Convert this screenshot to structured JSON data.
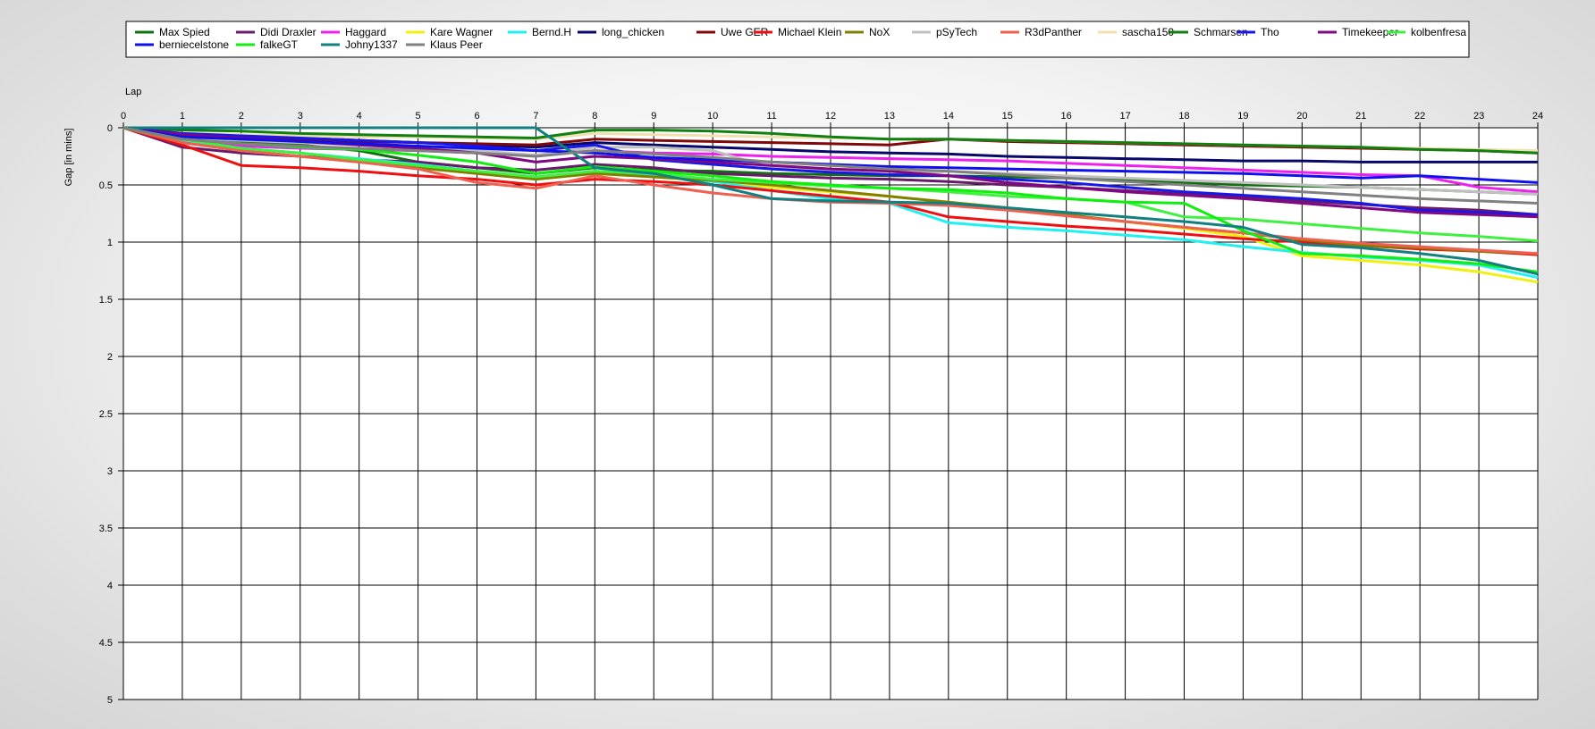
{
  "chart_data": {
    "type": "line",
    "xlabel": "Lap",
    "ylabel": "Gap [in mins]",
    "xlim": [
      0,
      24
    ],
    "ylim": [
      0,
      5
    ],
    "y_inverted": true,
    "x_ticks": [
      0,
      1,
      2,
      3,
      4,
      5,
      6,
      7,
      8,
      9,
      10,
      11,
      12,
      13,
      14,
      15,
      16,
      17,
      18,
      19,
      20,
      21,
      22,
      23,
      24
    ],
    "y_ticks": [
      0,
      0.5,
      1,
      1.5,
      2,
      2.5,
      3,
      3.5,
      4,
      4.5,
      5
    ],
    "grid": true,
    "legend_position": "top",
    "series": [
      {
        "name": "Max Spied",
        "color": "#107010",
        "values": [
          0,
          0.08,
          0.12,
          0.15,
          0.2,
          0.3,
          0.35,
          0.4,
          0.35,
          0.37,
          0.38,
          0.4,
          0.41,
          0.42,
          0.42,
          0.43,
          0.44,
          0.46,
          0.48,
          0.5,
          0.51,
          0.52,
          0.54,
          0.56,
          0.58
        ]
      },
      {
        "name": "Didi Draxler",
        "color": "#6a1a6a",
        "values": [
          0,
          0.17,
          0.22,
          0.25,
          0.28,
          0.3,
          0.35,
          0.37,
          0.32,
          0.35,
          0.4,
          0.42,
          0.44,
          0.45,
          0.47,
          0.5,
          0.52,
          0.55,
          0.58,
          0.61,
          0.64,
          0.67,
          0.7,
          0.72,
          0.76
        ]
      },
      {
        "name": "Haggard",
        "color": "#ee20ee",
        "values": [
          0,
          0.12,
          0.16,
          0.18,
          0.19,
          0.2,
          0.22,
          0.24,
          0.2,
          0.22,
          0.23,
          0.25,
          0.26,
          0.27,
          0.28,
          0.29,
          0.31,
          0.33,
          0.35,
          0.37,
          0.39,
          0.41,
          0.42,
          0.52,
          0.56
        ]
      },
      {
        "name": "Kare Wagner",
        "color": "#f0f010",
        "values": [
          0,
          0.12,
          0.2,
          0.25,
          0.3,
          0.35,
          0.4,
          0.45,
          0.4,
          0.43,
          0.47,
          0.52,
          0.56,
          0.6,
          0.65,
          0.7,
          0.76,
          0.82,
          0.88,
          0.95,
          1.12,
          1.16,
          1.2,
          1.26,
          1.35
        ]
      },
      {
        "name": "Bernd.H",
        "color": "#20f0f0",
        "values": [
          0,
          0.12,
          0.18,
          0.22,
          0.27,
          0.32,
          0.38,
          0.43,
          0.38,
          0.42,
          0.47,
          0.55,
          0.62,
          0.66,
          0.83,
          0.87,
          0.9,
          0.94,
          0.98,
          1.04,
          1.09,
          1.13,
          1.16,
          1.2,
          1.31
        ]
      },
      {
        "name": "long_chicken",
        "color": "#08086a",
        "values": [
          0,
          0.05,
          0.07,
          0.09,
          0.11,
          0.13,
          0.15,
          0.17,
          0.13,
          0.15,
          0.17,
          0.19,
          0.21,
          0.22,
          0.23,
          0.25,
          0.26,
          0.27,
          0.28,
          0.29,
          0.29,
          0.3,
          0.3,
          0.3,
          0.3
        ]
      },
      {
        "name": "Uwe GER",
        "color": "#800808",
        "values": [
          0,
          0.06,
          0.08,
          0.1,
          0.12,
          0.13,
          0.14,
          0.15,
          0.1,
          0.11,
          0.12,
          0.13,
          0.14,
          0.15,
          0.1,
          0.12,
          0.13,
          0.14,
          0.15,
          0.16,
          0.17,
          0.18,
          0.19,
          0.2,
          0.22
        ]
      },
      {
        "name": "Michael Klein",
        "color": "#ee1010",
        "values": [
          0,
          0.15,
          0.33,
          0.35,
          0.38,
          0.42,
          0.45,
          0.5,
          0.45,
          0.47,
          0.5,
          0.55,
          0.6,
          0.65,
          0.78,
          0.82,
          0.86,
          0.89,
          0.93,
          0.97,
          1.0,
          1.03,
          1.06,
          1.08,
          1.11
        ]
      },
      {
        "name": "NoX",
        "color": "#808000",
        "values": [
          0,
          0.13,
          0.2,
          0.25,
          0.3,
          0.35,
          0.4,
          0.45,
          0.4,
          0.43,
          0.46,
          0.5,
          0.55,
          0.6,
          0.65,
          0.7,
          0.76,
          0.82,
          0.87,
          0.92,
          0.98,
          1.03,
          1.05,
          1.08,
          1.1
        ]
      },
      {
        "name": "pSyTech",
        "color": "#c0c0c0",
        "values": [
          0,
          0.09,
          0.11,
          0.13,
          0.15,
          0.17,
          0.2,
          0.24,
          0.17,
          0.17,
          0.2,
          0.35,
          0.38,
          0.41,
          0.38,
          0.4,
          0.42,
          0.44,
          0.46,
          0.48,
          0.5,
          0.52,
          0.54,
          0.56,
          0.58
        ]
      },
      {
        "name": "R3dPanther",
        "color": "#f06050",
        "values": [
          0,
          0.13,
          0.2,
          0.25,
          0.3,
          0.36,
          0.48,
          0.53,
          0.42,
          0.5,
          0.57,
          0.62,
          0.65,
          0.66,
          0.68,
          0.72,
          0.77,
          0.82,
          0.87,
          0.92,
          0.97,
          1.01,
          1.04,
          1.07,
          1.1
        ]
      },
      {
        "name": "sascha150",
        "color": "#f0e0b0",
        "values": [
          0,
          0.05,
          0.06,
          0.07,
          0.08,
          0.08,
          0.09,
          0.1,
          0.05,
          0.06,
          0.07,
          0.08,
          0.09,
          0.1,
          0.1,
          0.11,
          0.12,
          0.13,
          0.14,
          0.15,
          0.16,
          0.17,
          0.18,
          0.19,
          0.2
        ]
      },
      {
        "name": "Schmarsen",
        "color": "#108010",
        "values": [
          0,
          0.02,
          0.03,
          0.05,
          0.06,
          0.07,
          0.08,
          0.09,
          0.02,
          0.02,
          0.03,
          0.05,
          0.08,
          0.1,
          0.1,
          0.11,
          0.12,
          0.13,
          0.14,
          0.15,
          0.16,
          0.17,
          0.19,
          0.2,
          0.22
        ]
      },
      {
        "name": "Tho",
        "color": "#1818e8",
        "values": [
          0,
          0.05,
          0.07,
          0.09,
          0.11,
          0.13,
          0.16,
          0.2,
          0.15,
          0.28,
          0.32,
          0.36,
          0.39,
          0.41,
          0.42,
          0.45,
          0.48,
          0.52,
          0.56,
          0.59,
          0.62,
          0.66,
          0.72,
          0.74,
          0.76
        ]
      },
      {
        "name": "Timekeeper",
        "color": "#800880",
        "values": [
          0,
          0.06,
          0.09,
          0.12,
          0.15,
          0.18,
          0.22,
          0.3,
          0.25,
          0.27,
          0.3,
          0.33,
          0.36,
          0.38,
          0.42,
          0.48,
          0.52,
          0.56,
          0.59,
          0.62,
          0.66,
          0.7,
          0.74,
          0.76,
          0.78
        ]
      },
      {
        "name": "kolbenfresa",
        "color": "#40f040",
        "values": [
          0,
          0.1,
          0.18,
          0.22,
          0.28,
          0.33,
          0.38,
          0.43,
          0.38,
          0.4,
          0.45,
          0.48,
          0.51,
          0.53,
          0.56,
          0.6,
          0.62,
          0.65,
          0.78,
          0.8,
          0.84,
          0.88,
          0.92,
          0.95,
          0.99
        ]
      },
      {
        "name": "berniecelstone",
        "color": "#1010ee",
        "values": [
          0,
          0.08,
          0.1,
          0.12,
          0.14,
          0.16,
          0.18,
          0.2,
          0.22,
          0.26,
          0.28,
          0.3,
          0.32,
          0.34,
          0.35,
          0.36,
          0.37,
          0.38,
          0.39,
          0.4,
          0.42,
          0.44,
          0.42,
          0.45,
          0.48
        ]
      },
      {
        "name": "falkeGT",
        "color": "#10ee10",
        "values": [
          0,
          0.1,
          0.14,
          0.17,
          0.19,
          0.24,
          0.3,
          0.4,
          0.34,
          0.38,
          0.42,
          0.47,
          0.5,
          0.53,
          0.54,
          0.57,
          0.62,
          0.65,
          0.66,
          0.9,
          1.1,
          1.12,
          1.15,
          1.19,
          1.26
        ]
      },
      {
        "name": "Johny1337",
        "color": "#108080",
        "values": [
          0,
          0.0,
          0.0,
          0.0,
          0.0,
          0.0,
          0.0,
          0.0,
          0.35,
          0.4,
          0.5,
          0.62,
          0.64,
          0.65,
          0.66,
          0.7,
          0.74,
          0.78,
          0.82,
          0.87,
          1.02,
          1.05,
          1.1,
          1.16,
          1.28
        ]
      },
      {
        "name": "Klaus Peer",
        "color": "#808080",
        "values": [
          0,
          0.1,
          0.14,
          0.16,
          0.18,
          0.2,
          0.22,
          0.25,
          0.2,
          0.23,
          0.26,
          0.3,
          0.33,
          0.36,
          0.38,
          0.41,
          0.44,
          0.47,
          0.5,
          0.53,
          0.56,
          0.59,
          0.62,
          0.64,
          0.66
        ]
      }
    ]
  }
}
